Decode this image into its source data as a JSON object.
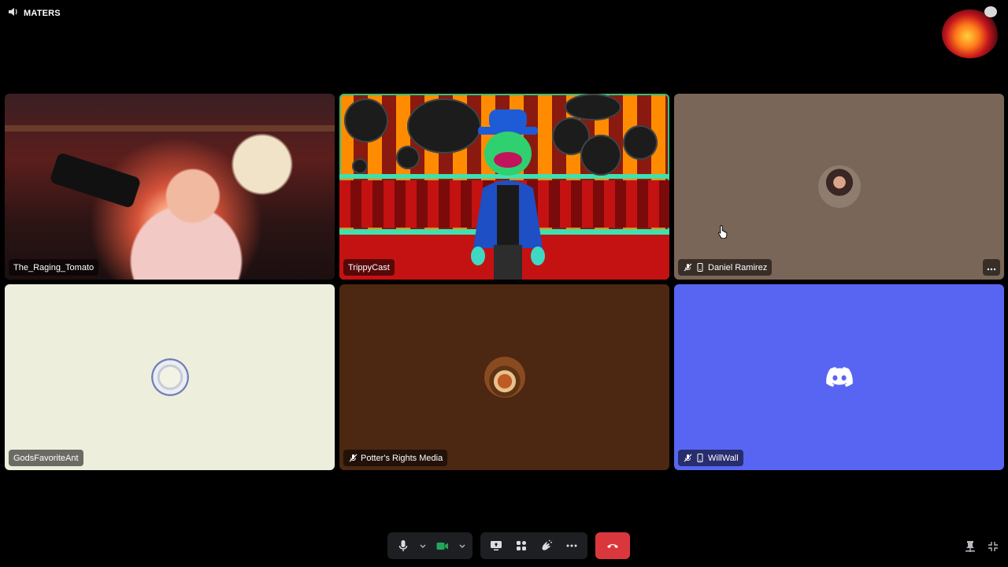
{
  "channel": {
    "name": "MATERS",
    "icon": "speaker-icon"
  },
  "tiles": [
    {
      "name": "The_Raging_Tomato",
      "kind": "camera"
    },
    {
      "name": "TrippyCast",
      "kind": "camera",
      "speaking": true
    },
    {
      "name": "Daniel Ramirez",
      "kind": "avatar",
      "muted": true,
      "mobile": true,
      "bg": "#7a6658"
    },
    {
      "name": "GodsFavoriteAnt",
      "kind": "avatar",
      "bg": "#eeeedd"
    },
    {
      "name": "Potter's Rights Media",
      "kind": "avatar",
      "muted": true,
      "bg": "#4c2712"
    },
    {
      "name": "WillWall",
      "kind": "discord-default",
      "muted": true,
      "mobile": true,
      "bg": "#5865f2"
    }
  ],
  "controls": {
    "mic": "microphone-icon",
    "camera": "video-camera-icon",
    "share": "screen-share-icon",
    "activities": "activities-icon",
    "soundboard": "soundboard-icon",
    "more": "more-icon",
    "disconnect": "disconnect-icon",
    "camera_active_color": "#23a55a",
    "disconnect_color": "#da373c"
  },
  "corner": {
    "pin": "pin-icon",
    "exit_fullscreen": "exit-fullscreen-icon"
  }
}
